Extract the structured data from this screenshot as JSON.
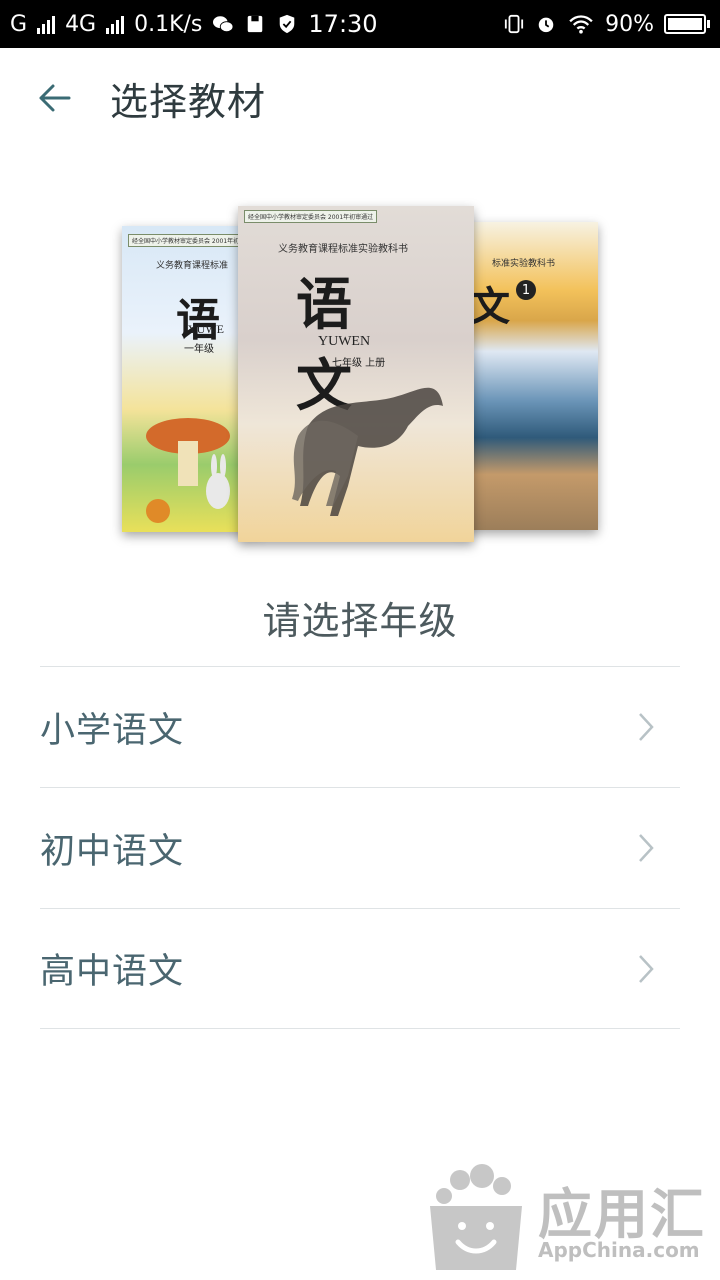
{
  "status_bar": {
    "carrier": "G",
    "network": "4G",
    "speed": "0.1K/s",
    "time": "17:30",
    "battery": "90%",
    "icons": [
      "signal-icon",
      "signal-icon",
      "wechat-icon",
      "notification-icon",
      "shield-icon",
      "vibrate-icon",
      "alarm-icon",
      "wifi-icon",
      "battery-charging-icon"
    ]
  },
  "header": {
    "back_icon": "arrow-left-icon",
    "title": "选择教材"
  },
  "books": {
    "center": {
      "stamp": "经全国中小学教材审定委员会 2001年初审通过",
      "series": "义务教育课程标准实验教科书",
      "title": "语 文",
      "latin": "YUWEN",
      "grade": "七年级 上册"
    },
    "left": {
      "stamp": "经全国中小学教材审定委员会 2001年初审通过",
      "series": "义务教育课程标准",
      "title": "语",
      "latin": "YUWE",
      "grade": "一年级"
    },
    "right": {
      "series": "标准实验教科书",
      "title": "文",
      "volume": "1"
    }
  },
  "prompt": "请选择年级",
  "grades": [
    {
      "label": "小学语文",
      "icon": "chevron-right-icon"
    },
    {
      "label": "初中语文",
      "icon": "chevron-right-icon"
    },
    {
      "label": "高中语文",
      "icon": "chevron-right-icon"
    }
  ],
  "watermark": {
    "name": "应用汇",
    "domain": "AppChina.com"
  },
  "colors": {
    "status_bar_bg": "#000000",
    "title_text": "#2f3b3f",
    "back_arrow": "#3a6b74",
    "list_text": "#4a6670",
    "divider": "#dfe3e5",
    "chevron": "#b8c2c6"
  }
}
